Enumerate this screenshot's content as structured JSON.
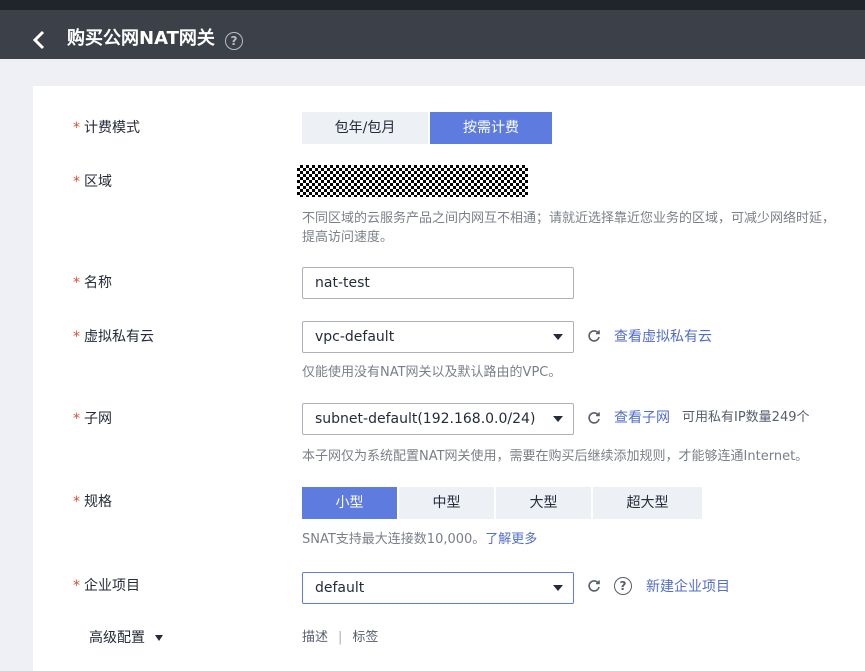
{
  "header": {
    "title": "购买公网NAT网关",
    "help_icon": "question-circle-icon"
  },
  "form": {
    "billing": {
      "label": "计费模式",
      "options": [
        "包年/包月",
        "按需计费"
      ],
      "selected": "按需计费"
    },
    "region": {
      "label": "区域",
      "hint_line1": "不同区域的云服务产品之间内网互不相通；请就近选择靠近您业务的区域，可减少网络时延，",
      "hint_line2": "提高访问速度。"
    },
    "name": {
      "label": "名称",
      "value": "nat-test"
    },
    "vpc": {
      "label": "虚拟私有云",
      "value": "vpc-default",
      "link": "查看虚拟私有云",
      "hint": "仅能使用没有NAT网关以及默认路由的VPC。"
    },
    "subnet": {
      "label": "子网",
      "value": "subnet-default(192.168.0.0/24)",
      "link": "查看子网",
      "extra": "可用私有IP数量249个",
      "hint": "本子网仅为系统配置NAT网关使用，需要在购买后继续添加规则，才能够连通Internet。"
    },
    "spec": {
      "label": "规格",
      "options": [
        "小型",
        "中型",
        "大型",
        "超大型"
      ],
      "selected": "小型",
      "hint": "SNAT支持最大连接数10,000。",
      "hint_link": "了解更多"
    },
    "project": {
      "label": "企业项目",
      "value": "default",
      "link": "新建企业项目"
    },
    "advanced": {
      "label": "高级配置",
      "items": [
        "描述",
        "标签"
      ],
      "separator": "|"
    }
  },
  "colors": {
    "accent": "#5e7ce0",
    "link": "#526ecc",
    "required": "#e64a2d",
    "header_bg": "#3c4049"
  }
}
